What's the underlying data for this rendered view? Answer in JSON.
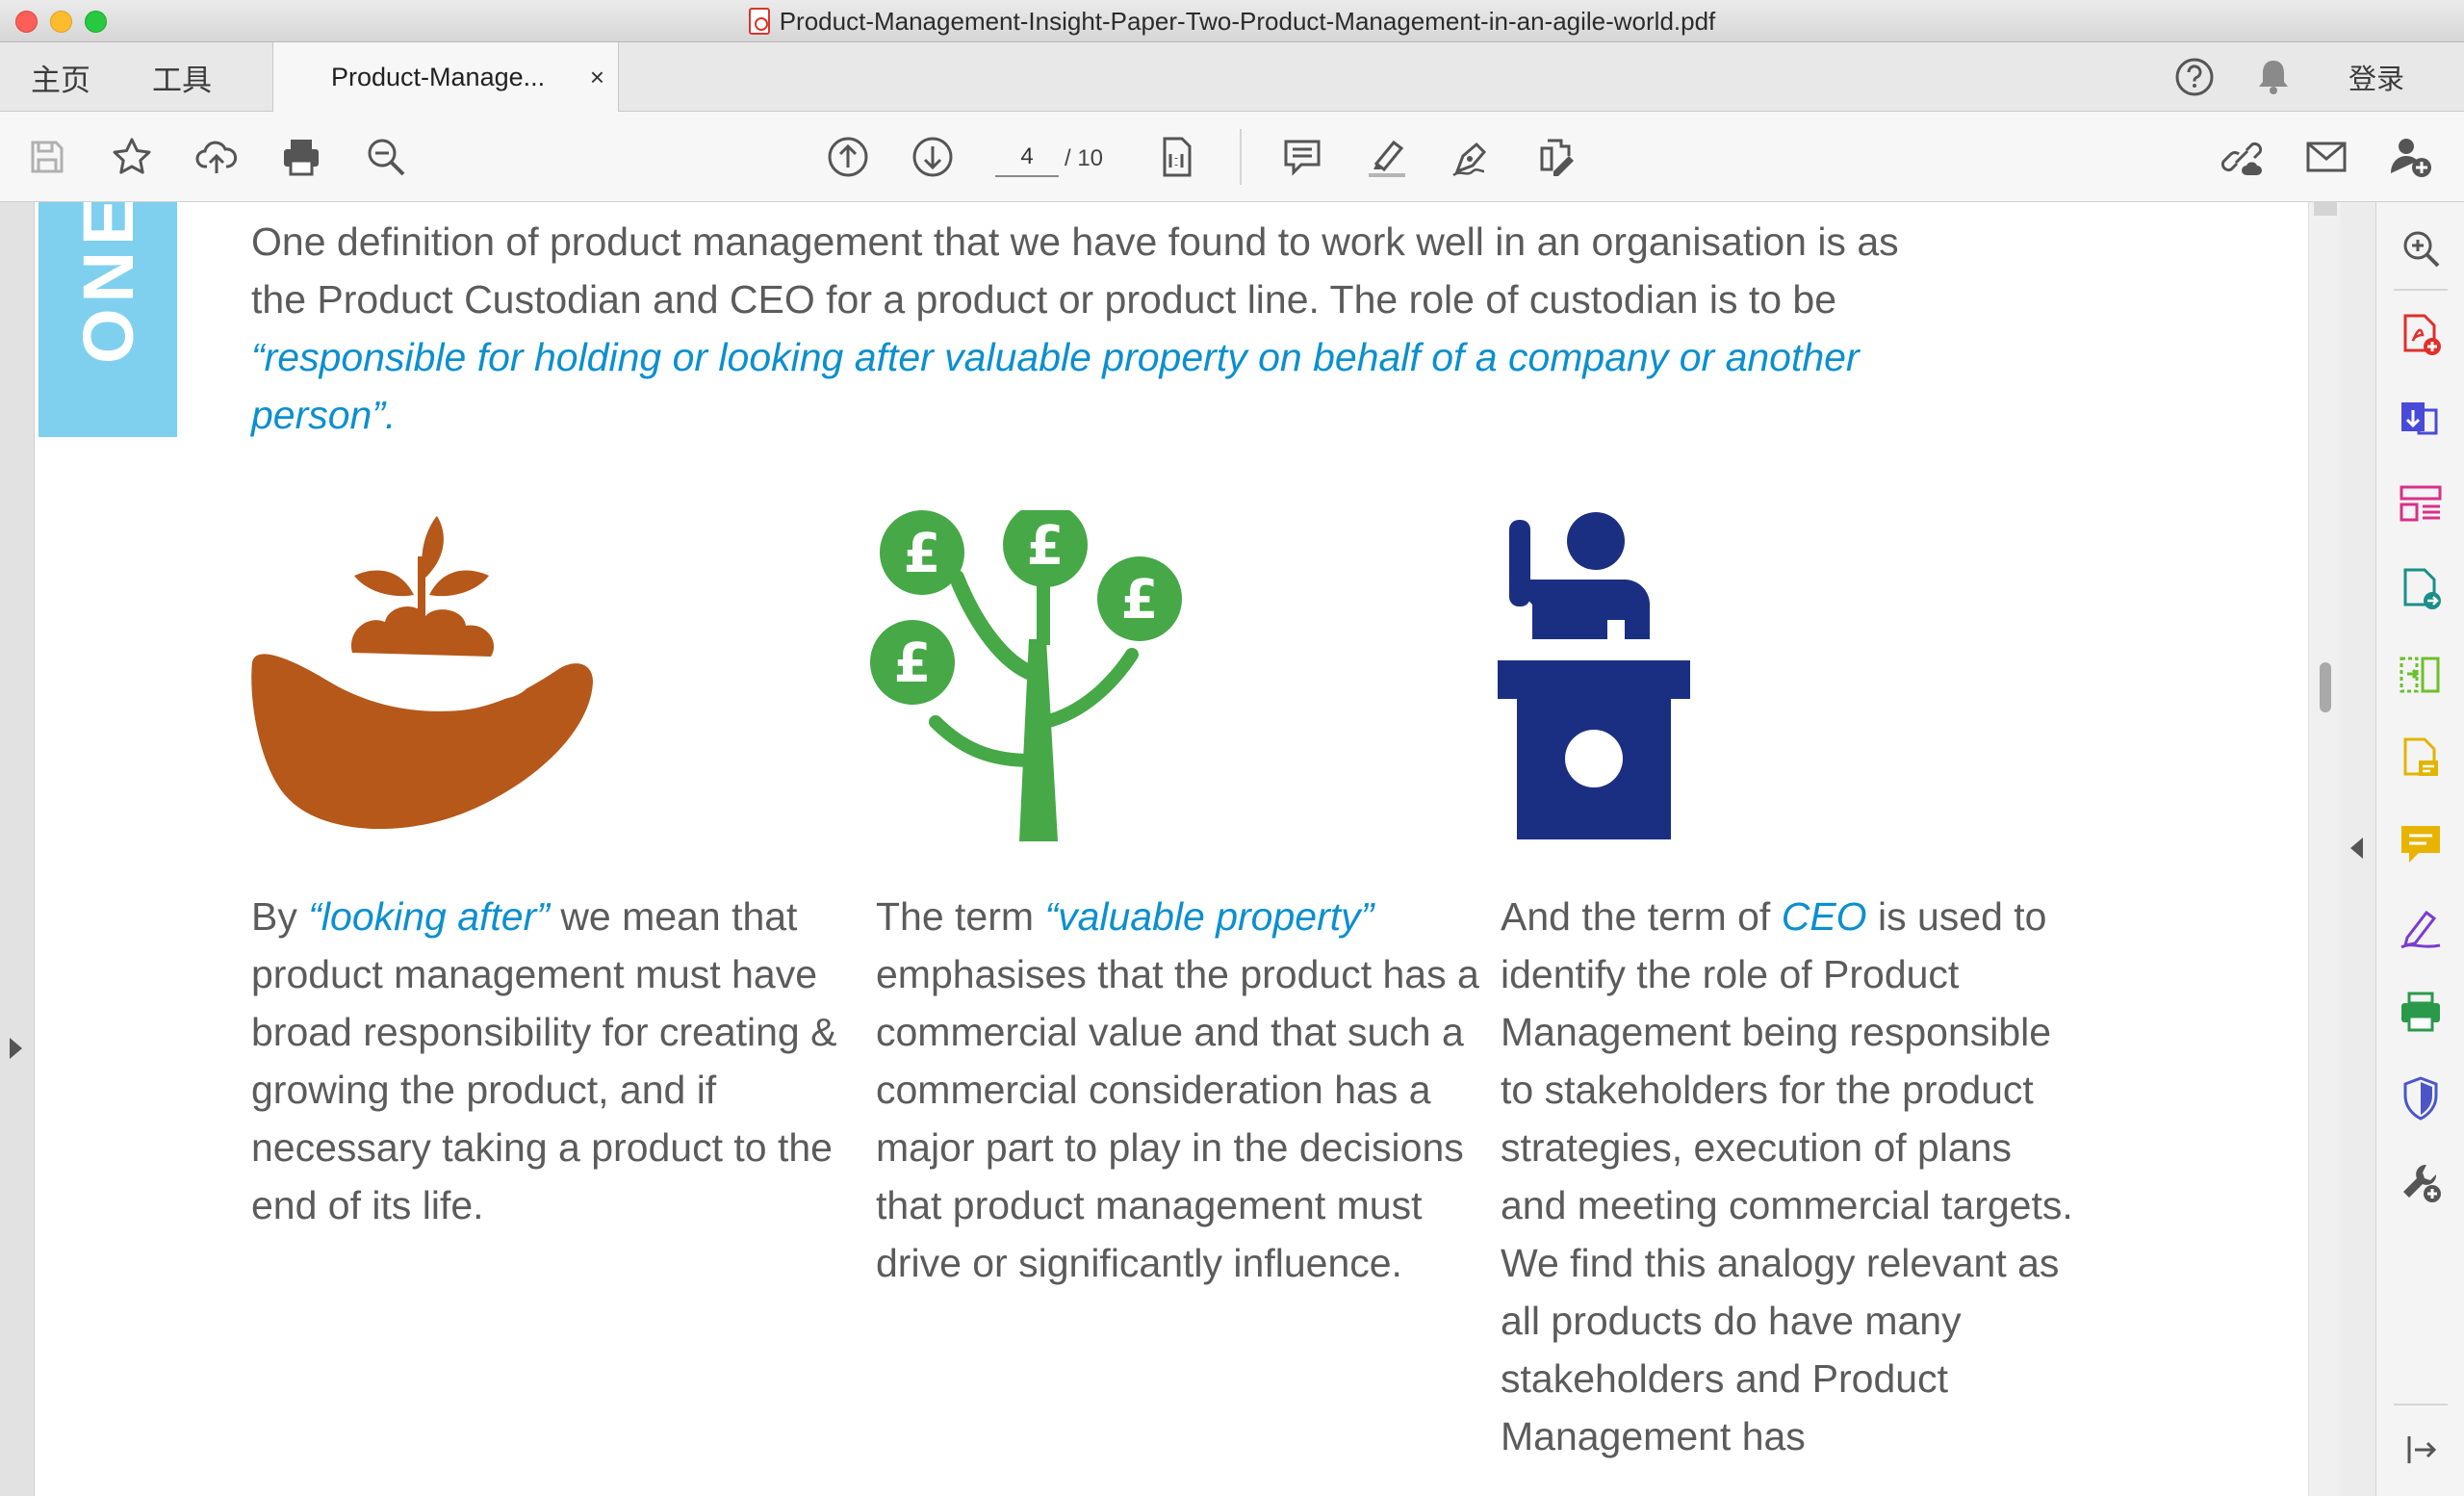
{
  "window": {
    "title": "Product-Management-Insight-Paper-Two-Product-Management-in-an-agile-world.pdf"
  },
  "tabs": {
    "home_label": "主页",
    "tools_label": "工具",
    "doc_label": "Product-Manage...",
    "close_glyph": "×",
    "signin_label": "登录"
  },
  "toolbar": {
    "page_current": "4",
    "page_total": "/ 10"
  },
  "document": {
    "section_tag": "ONE",
    "intro_plain": "One definition of product management that we have found to work well in an organisation is as the Product Custodian and CEO for a product or product line. The role of custodian is to be ",
    "intro_quote": "“responsible for holding or looking after valuable property on behalf of a company or another person”.",
    "col1": {
      "pre": "By ",
      "highlight": "“looking after”",
      "post": " we mean that product management must have broad responsibility for creating & growing the product, and if necessary taking a product to the end of its life."
    },
    "col2": {
      "pre": "The term ",
      "highlight": "“valuable property”",
      "post": " emphasises that the product has a commercial value and that such a commercial consideration has a major part to play in the decisions that product management must drive or significantly influence."
    },
    "col3": {
      "pre": "And the term of ",
      "highlight": "CEO",
      "post": " is used to identify the role of Product Management being responsible to stakeholders for the product strategies, execution of plans and meeting commercial targets. We find this analogy relevant as all products do have many stakeholders and Product Management has"
    },
    "pound_glyph": "£"
  },
  "colors": {
    "accent_blue": "#0b8fcf",
    "band_blue": "#7fd0ef",
    "plant_brown": "#b5581a",
    "tree_green": "#46a846",
    "podium_navy": "#1b2f82"
  }
}
